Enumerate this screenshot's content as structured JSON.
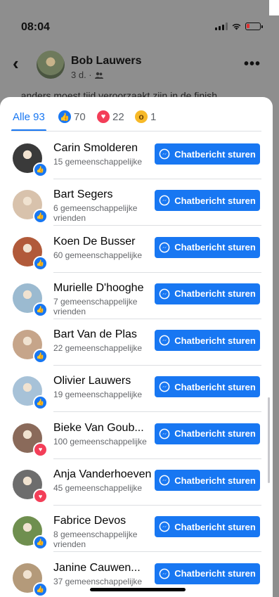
{
  "status_bar": {
    "time": "08:04"
  },
  "post": {
    "author": "Bob Lauwers",
    "meta": "3 d. ·",
    "peek_text": "...anders moest tijd veroorzaakt zijn in de finish"
  },
  "reactions_tabs": [
    {
      "label": "Alle 93",
      "kind": "all"
    },
    {
      "label": "70",
      "kind": "like"
    },
    {
      "label": "22",
      "kind": "love"
    },
    {
      "label": "1",
      "kind": "wow"
    }
  ],
  "button_label": "Chatbericht sturen",
  "people": [
    {
      "name": "Carin Smolderen",
      "sub": "15 gemeenschappelijke",
      "reaction": "like",
      "avatar": "#3a3a3a"
    },
    {
      "name": "Bart Segers",
      "sub": "6 gemeenschappelijke vrienden",
      "reaction": "like",
      "avatar": "#d8c2ac"
    },
    {
      "name": "Koen De Busser",
      "sub": "60 gemeenschappelijke",
      "reaction": "like",
      "avatar": "#b15a3a"
    },
    {
      "name": "Murielle D'hooghe",
      "sub": "7 gemeenschappelijke vrienden",
      "reaction": "like",
      "avatar": "#9bbad0"
    },
    {
      "name": "Bart Van de Plas",
      "sub": "22 gemeenschappelijke",
      "reaction": "like",
      "avatar": "#c6a58a"
    },
    {
      "name": "Olivier Lauwers",
      "sub": "19 gemeenschappelijke",
      "reaction": "like",
      "avatar": "#a7c2d8"
    },
    {
      "name": "Bieke Van Goub...",
      "sub": "100 gemeenschappelijke",
      "reaction": "love",
      "avatar": "#8a6a5a"
    },
    {
      "name": "Anja Vanderhoeven",
      "sub": "45 gemeenschappelijke",
      "reaction": "love",
      "avatar": "#6d6d6d"
    },
    {
      "name": "Fabrice Devos",
      "sub": "8 gemeenschappelijke vrienden",
      "reaction": "like",
      "avatar": "#6f8f4f"
    },
    {
      "name": "Janine Cauwen...",
      "sub": "37 gemeenschappelijke",
      "reaction": "like",
      "avatar": "#b49a7a"
    }
  ]
}
